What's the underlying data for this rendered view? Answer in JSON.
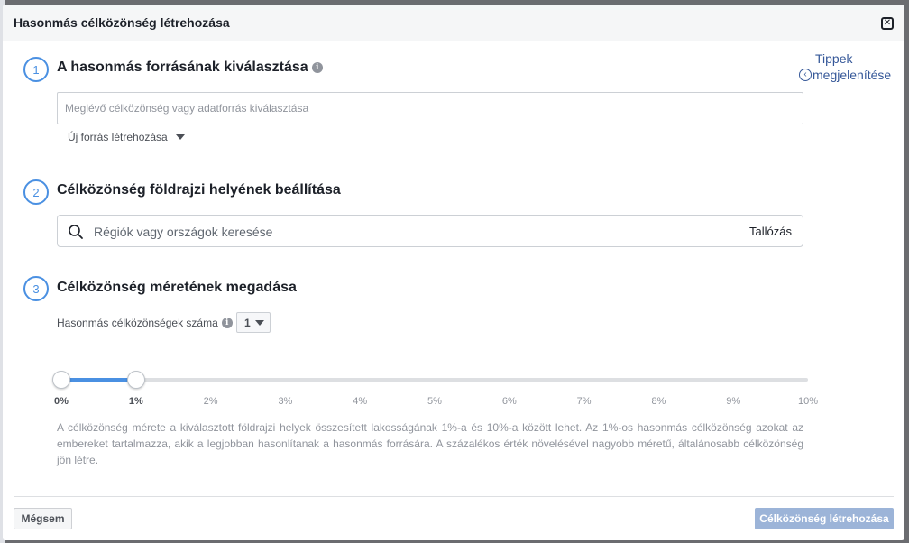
{
  "dialog": {
    "title": "Hasonmás célközönség létrehozása",
    "close_icon": "close-icon",
    "tips": {
      "line1": "Tippek",
      "line2": "megjelenítése",
      "icon": "chevron-left-icon"
    }
  },
  "step1": {
    "number": "1",
    "title": "A hasonmás forrásának kiválasztása",
    "info_icon": "i",
    "source_placeholder": "Meglévő célközönség vagy adatforrás kiválasztása",
    "new_source_label": "Új forrás létrehozása"
  },
  "step2": {
    "number": "2",
    "title": "Célközönség földrajzi helyének beállítása",
    "search_placeholder": "Régiók vagy országok keresése",
    "browse_label": "Tallózás"
  },
  "step3": {
    "number": "3",
    "title": "Célközönség méretének megadása",
    "count_label": "Hasonmás célközönségek száma",
    "count_info": "i",
    "count_value": "1",
    "slider": {
      "min_percent": 0,
      "max_percent": 10,
      "range_start": 0,
      "range_end": 1,
      "ticks": [
        "0%",
        "1%",
        "2%",
        "3%",
        "4%",
        "5%",
        "6%",
        "7%",
        "8%",
        "9%",
        "10%"
      ]
    },
    "description": "A célközönség mérete a kiválasztott földrajzi helyek összesített lakosságának 1%-a és 10%-a között lehet. Az 1%-os hasonmás célközönség azokat az embereket tartalmazza, akik a legjobban hasonlítanak a hasonmás forrására. A százalékos érték növelésével nagyobb méretű, általánosabb célközönség jön létre."
  },
  "footer": {
    "cancel_label": "Mégsem",
    "create_label": "Célközönség létrehozása"
  },
  "colors": {
    "accent": "#4a90e2",
    "link": "#365899",
    "disabled_primary": "#9cb4d8"
  }
}
